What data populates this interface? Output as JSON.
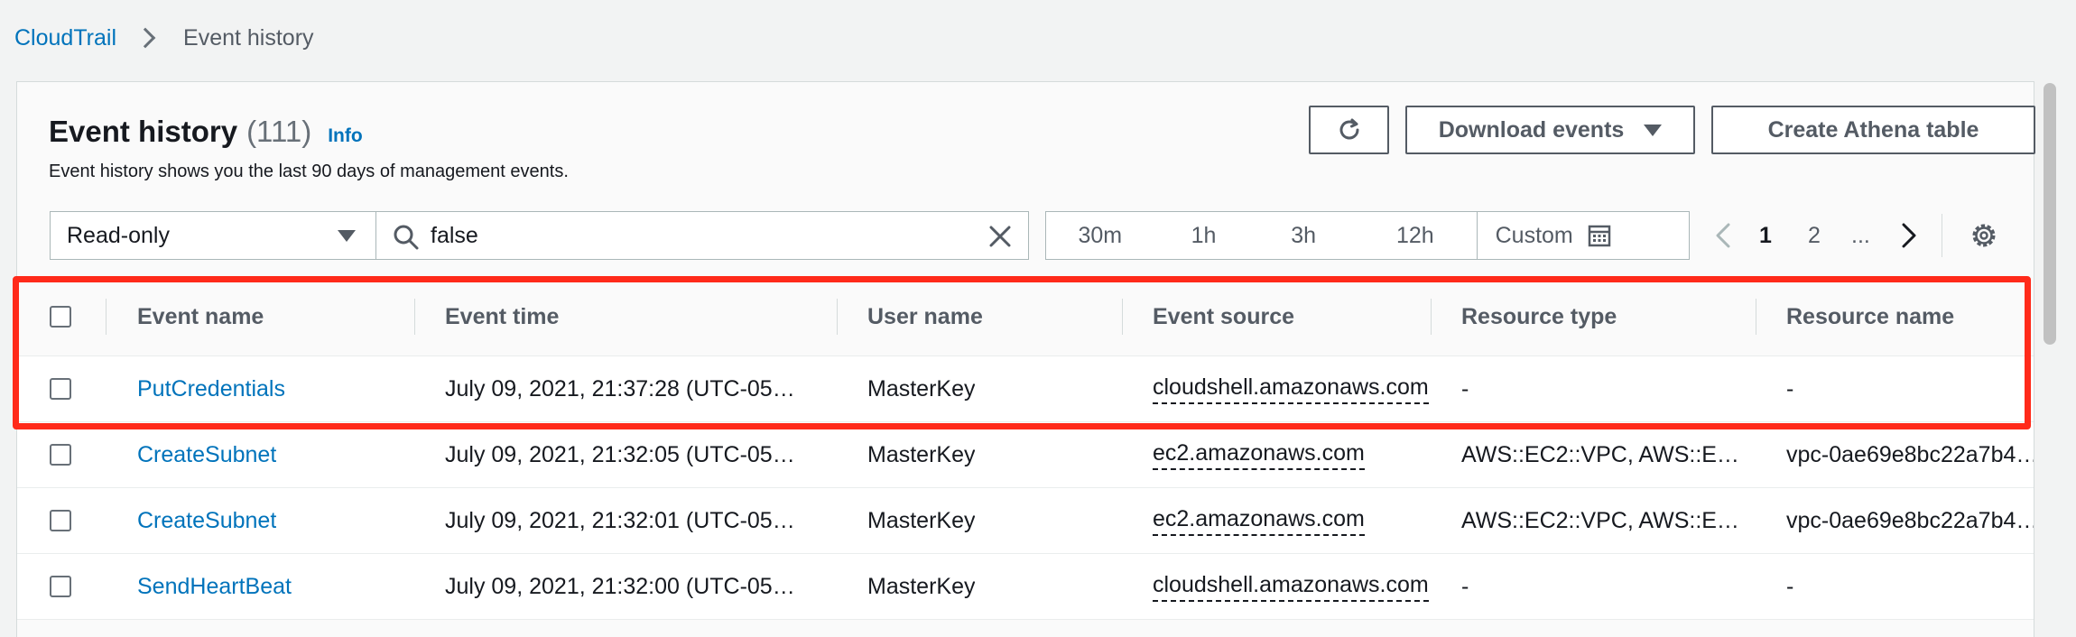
{
  "breadcrumb": {
    "root": "CloudTrail",
    "current": "Event history"
  },
  "header": {
    "title": "Event history",
    "count": "(111)",
    "info": "Info",
    "description": "Event history shows you the last 90 days of management events."
  },
  "actions": {
    "refresh_icon": "refresh-icon",
    "download_label": "Download events",
    "athena_label": "Create Athena table"
  },
  "filter": {
    "attribute": "Read-only",
    "search_value": "false"
  },
  "time_range": {
    "options": [
      "30m",
      "1h",
      "3h",
      "12h"
    ],
    "custom": "Custom"
  },
  "pagination": {
    "pages": [
      "1",
      "2"
    ],
    "current": "1",
    "ellipsis": "..."
  },
  "table": {
    "columns": [
      "Event name",
      "Event time",
      "User name",
      "Event source",
      "Resource type",
      "Resource name"
    ],
    "rows": [
      {
        "name": "PutCredentials",
        "time": "July 09, 2021, 21:37:28 (UTC-05…",
        "user": "MasterKey",
        "source": "cloudshell.amazonaws.com",
        "rtype": "-",
        "rname": "-"
      },
      {
        "name": "CreateSubnet",
        "time": "July 09, 2021, 21:32:05 (UTC-05…",
        "user": "MasterKey",
        "source": "ec2.amazonaws.com",
        "rtype": "AWS::EC2::VPC, AWS::E…",
        "rname": "vpc-0ae69e8bc22a7b4…"
      },
      {
        "name": "CreateSubnet",
        "time": "July 09, 2021, 21:32:01 (UTC-05…",
        "user": "MasterKey",
        "source": "ec2.amazonaws.com",
        "rtype": "AWS::EC2::VPC, AWS::E…",
        "rname": "vpc-0ae69e8bc22a7b4…"
      },
      {
        "name": "SendHeartBeat",
        "time": "July 09, 2021, 21:32:00 (UTC-05…",
        "user": "MasterKey",
        "source": "cloudshell.amazonaws.com",
        "rtype": "-",
        "rname": "-"
      }
    ]
  },
  "colors": {
    "link": "#0073bb",
    "highlight": "#ff2a1a",
    "border": "#aab7b8"
  }
}
